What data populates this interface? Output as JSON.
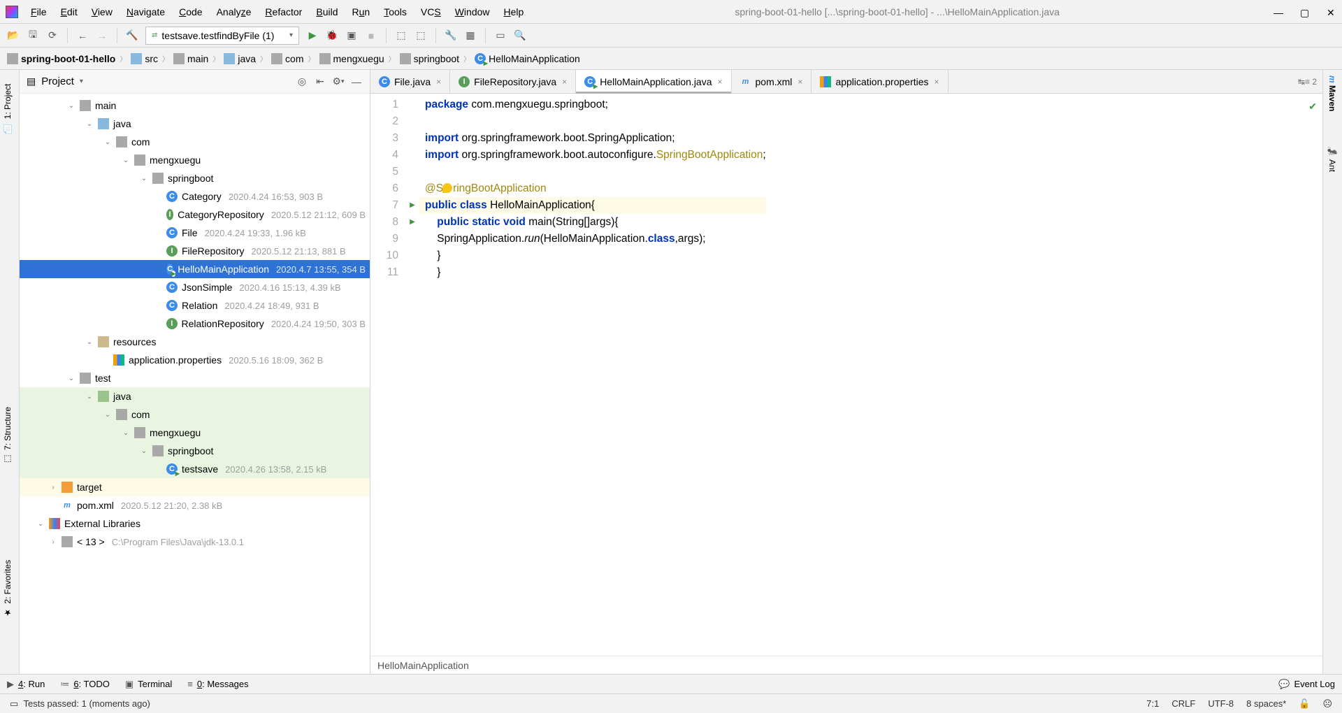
{
  "menubar": {
    "File": "File",
    "Edit": "Edit",
    "View": "View",
    "Navigate": "Navigate",
    "Code": "Code",
    "Analyze": "Analyze",
    "Refactor": "Refactor",
    "Build": "Build",
    "Run": "Run",
    "Tools": "Tools",
    "VCS": "VCS",
    "Window": "Window",
    "Help": "Help"
  },
  "title": "spring-boot-01-hello [...\\spring-boot-01-hello] - ...\\HelloMainApplication.java",
  "runconfig": "testsave.testfindByFile (1)",
  "breadcrumb": [
    "spring-boot-01-hello",
    "src",
    "main",
    "java",
    "com",
    "mengxuegu",
    "springboot",
    "HelloMainApplication"
  ],
  "project": {
    "header": "Project",
    "nodes": {
      "main": "main",
      "java": "java",
      "com": "com",
      "mengxuegu": "mengxuegu",
      "springboot": "springboot",
      "resources": "resources",
      "test": "test",
      "target": "target",
      "pom": "pom.xml",
      "ext": "External Libraries",
      "jdk": "< 13 >",
      "jdkpath": "C:\\Program Files\\Java\\jdk-13.0.1",
      "Category": {
        "n": "Category",
        "m": "2020.4.24 16:53, 903 B"
      },
      "CategoryRepository": {
        "n": "CategoryRepository",
        "m": "2020.5.12 21:12, 609 B"
      },
      "File": {
        "n": "File",
        "m": "2020.4.24 19:33, 1.96 kB"
      },
      "FileRepository": {
        "n": "FileRepository",
        "m": "2020.5.12 21:13, 881 B"
      },
      "HelloMain": {
        "n": "HelloMainApplication",
        "m": "2020.4.7 13:55, 354 B"
      },
      "JsonSimple": {
        "n": "JsonSimple",
        "m": "2020.4.16 15:13, 4.39 kB"
      },
      "Relation": {
        "n": "Relation",
        "m": "2020.4.24 18:49, 931 B"
      },
      "RelationRepository": {
        "n": "RelationRepository",
        "m": "2020.4.24 19:50, 303 B"
      },
      "appprops": {
        "n": "application.properties",
        "m": "2020.5.16 18:09, 362 B"
      },
      "testsave": {
        "n": "testsave",
        "m": "2020.4.26 13:58, 2.15 kB"
      },
      "pommeta": "2020.5.12 21:20, 2.38 kB"
    }
  },
  "tabs": [
    "File.java",
    "FileRepository.java",
    "HelloMainApplication.java",
    "pom.xml",
    "application.properties"
  ],
  "tabsEnd": "↹≡ 2",
  "code": {
    "l1a": "package",
    "l1b": " com.mengxuegu.springboot;",
    "l3a": "import",
    "l3b": " org.springframework.boot.SpringApplication;",
    "l4a": "import",
    "l4b": " org.springframework.boot.autoconfigure.",
    "l4c": "SpringBootApplication",
    "l4d": ";",
    "l6": "@SpringBootApplication",
    "l7a": "public class ",
    "l7b": "HelloMainApplication{",
    "l8a": "public static void ",
    "l8b": "main(String[]args){",
    "l9a": "SpringApplication.",
    "l9b": "run",
    "l9c": "(HelloMainApplication.",
    "l9d": "class",
    "l9e": ",args);",
    "l10": "}",
    "l11": "}"
  },
  "editorStatus": "HelloMainApplication",
  "bottomTools": {
    "run": "4: Run",
    "todo": "6: TODO",
    "terminal": "Terminal",
    "messages": "0: Messages",
    "eventlog": "Event Log"
  },
  "status": {
    "msg": "Tests passed: 1 (moments ago)",
    "pos": "7:1",
    "sep": "CRLF",
    "enc": "UTF-8",
    "indent": "8 spaces*"
  },
  "sideTabs": {
    "project": "1: Project",
    "structure": "7: Structure",
    "favorites": "2: Favorites",
    "maven": "Maven",
    "ant": "Ant"
  }
}
